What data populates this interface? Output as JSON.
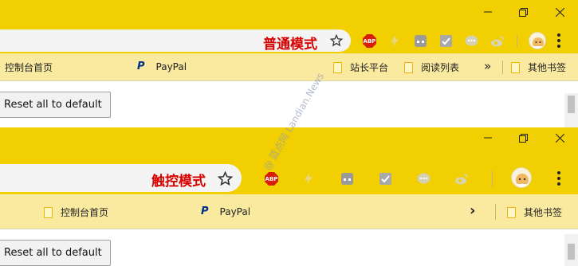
{
  "normal": {
    "mode_label": "普通模式",
    "bookmarks": [
      "控制台首页",
      "PayPal",
      "站长平台",
      "阅读列表",
      "其他书签"
    ],
    "more_chevron": "»",
    "reset_button": "Reset all to default"
  },
  "touch": {
    "mode_label": "触控模式",
    "bookmarks": [
      "控制台首页",
      "PayPal",
      "其他书签"
    ],
    "more_chevron": "›",
    "reset_button": "Reset all to default"
  },
  "extensions": {
    "abp": "ABP",
    "icons": [
      "abp-icon",
      "lightning-icon",
      "gamepad-icon",
      "checkbox-icon",
      "chat-icon",
      "weibo-icon"
    ]
  },
  "watermark": {
    "prefix": "@",
    "text": "蓝点网 Landian.News"
  },
  "colors": {
    "titlebar": "#f1cf00",
    "bookmarks_bar": "#f9eaa0",
    "mode_label": "#d60000"
  }
}
